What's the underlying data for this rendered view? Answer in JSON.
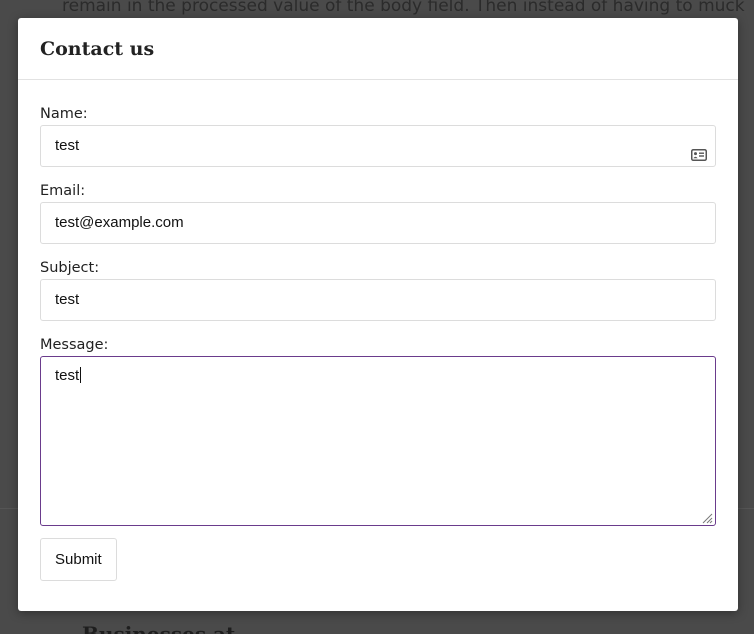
{
  "background": {
    "text_line": "remain in the processed value of the body field. Then instead of having to muck",
    "heading": "Businesses at"
  },
  "modal": {
    "title": "Contact us",
    "fields": {
      "name": {
        "label": "Name:",
        "value": "test",
        "icon": "contact-card-icon"
      },
      "email": {
        "label": "Email:",
        "value": "test@example.com"
      },
      "subject": {
        "label": "Subject:",
        "value": "test"
      },
      "message": {
        "label": "Message:",
        "value": "test"
      }
    },
    "submit_label": "Submit"
  },
  "colors": {
    "focus_border": "#6a3b8c",
    "overlay": "#3d3d3d",
    "input_border": "#dcdcdc"
  }
}
